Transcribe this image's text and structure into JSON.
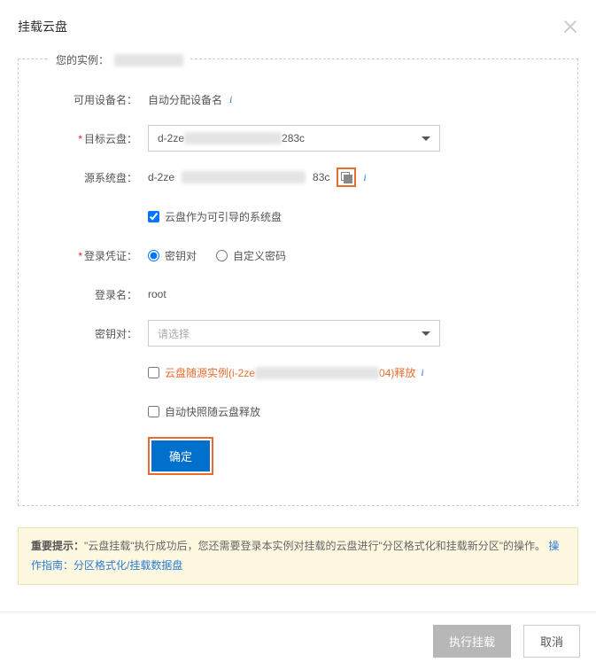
{
  "dialog": {
    "title": "挂载云盘"
  },
  "instance": {
    "legend_label": "您的实例：",
    "blurred_id": "████████"
  },
  "fields": {
    "device_name": {
      "label": "可用设备名：",
      "value": "自动分配设备名"
    },
    "target_disk": {
      "label": "目标云盘：",
      "prefix": "d-2ze",
      "suffix": "283c"
    },
    "source_disk": {
      "label": "源系统盘：",
      "prefix": "d-2ze",
      "suffix": "83c"
    },
    "bootable": {
      "label": "云盘作为可引导的系统盘",
      "checked": true
    },
    "credential": {
      "label": "登录凭证：",
      "option_keypair": "密钥对",
      "option_password": "自定义密码",
      "selected": "keypair"
    },
    "login_name": {
      "label": "登录名：",
      "value": "root"
    },
    "keypair_select": {
      "label": "密钥对：",
      "placeholder": "请选择"
    },
    "release_with_instance": {
      "prefix": "云盘随源实例(i-2ze",
      "suffix": "04)释放",
      "checked": false
    },
    "release_snapshot": {
      "label": "自动快照随云盘释放",
      "checked": false
    },
    "confirm_btn": "确定"
  },
  "warning": {
    "bold": "重要提示：",
    "line": "\"云盘挂载\"执行成功后，您还需要登录本实例对挂载的云盘进行\"分区格式化和挂载新分区\"的操作。",
    "link": "操作指南：分区格式化/挂载数据盘"
  },
  "footer": {
    "execute": "执行挂载",
    "cancel": "取消"
  }
}
